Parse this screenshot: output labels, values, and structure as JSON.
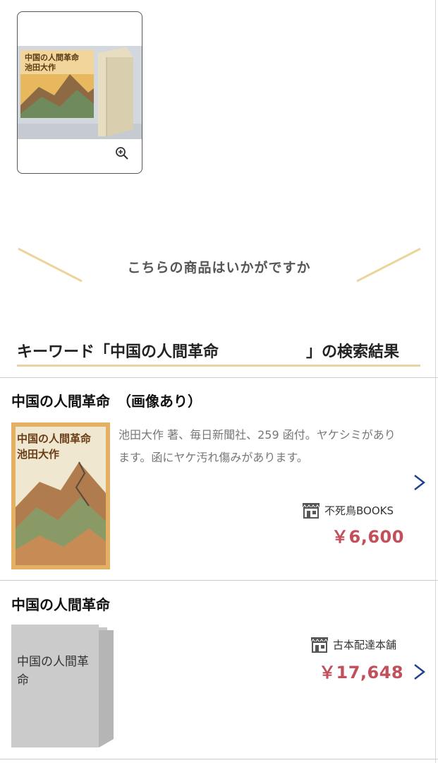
{
  "suggestion": {
    "title": "こちらの商品はいかがですか"
  },
  "results": {
    "heading_prefix": "キーワード「中国の人間革命",
    "heading_suffix": "」の検索結果",
    "items": [
      {
        "title": "中国の人間革命　（画像あり）",
        "description": "池田大作 著、毎日新聞社、259 函付。ヤケシミがあります。函にヤケ汚れ傷みがあります。",
        "seller": "不死鳥BOOKS",
        "price": "￥6,600"
      },
      {
        "title": "中国の人間革命",
        "placeholder_text": "中国の人間革命",
        "seller": "古本配達本舗",
        "price": "￥17,648"
      }
    ]
  },
  "icons": {
    "zoom": "zoom-in-icon",
    "store": "store-icon",
    "chevron": "chevron-right-icon"
  },
  "colors": {
    "price": "#c2505a",
    "accent_gold": "#e9d3a4",
    "chevron": "#1f3f8f"
  }
}
